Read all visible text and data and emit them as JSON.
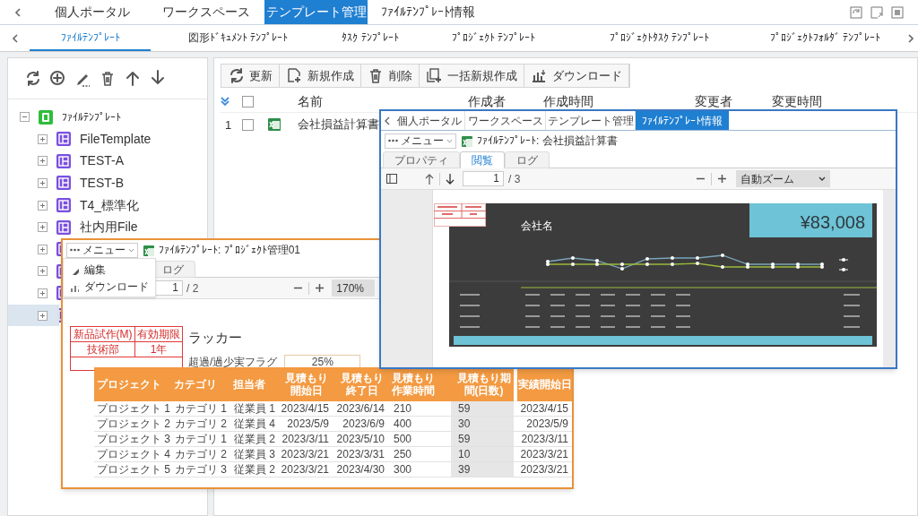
{
  "top_tabs": [
    {
      "label": "個人ポータル",
      "selected": false
    },
    {
      "label": "ワークスペース",
      "selected": false
    },
    {
      "label": "テンプレート管理",
      "selected": true
    },
    {
      "label": "ﾌｧｲﾙﾃﾝﾌﾟﾚｰﾄ情報",
      "selected": false
    }
  ],
  "sub_tabs": [
    {
      "label": "ﾌｧｲﾙﾃﾝﾌﾟﾚｰﾄ",
      "selected": true
    },
    {
      "label": "図形ﾄﾞｷｭﾒﾝﾄ ﾃﾝﾌﾟﾚｰﾄ",
      "selected": false
    },
    {
      "label": "ﾀｽｸ ﾃﾝﾌﾟﾚｰﾄ",
      "selected": false
    },
    {
      "label": "ﾌﾟﾛｼﾞｪｸﾄ ﾃﾝﾌﾟﾚｰﾄ",
      "selected": false
    },
    {
      "label": "ﾌﾟﾛｼﾞｪｸﾄﾀｽｸ ﾃﾝﾌﾟﾚｰﾄ",
      "selected": false
    },
    {
      "label": "ﾌﾟﾛｼﾞｪｸﾄﾌｫﾙﾀﾞ ﾃﾝﾌﾟﾚｰﾄ",
      "selected": false
    }
  ],
  "tree": {
    "root": {
      "label": "ﾌｧｲﾙﾃﾝﾌﾟﾚｰﾄ",
      "expanded": true,
      "children": [
        {
          "label": "FileTemplate",
          "expanded": false,
          "selected": false
        },
        {
          "label": "TEST-A",
          "expanded": false,
          "selected": false
        },
        {
          "label": "TEST-B",
          "expanded": false,
          "selected": false
        },
        {
          "label": "T4_標準化",
          "expanded": false,
          "selected": false
        },
        {
          "label": "社内用File",
          "expanded": false,
          "selected": false
        },
        {
          "expanded": false,
          "selected": false
        },
        {
          "expanded": false,
          "selected": false
        },
        {
          "expanded": false,
          "selected": false
        },
        {
          "expanded": false,
          "selected": true
        }
      ]
    }
  },
  "toolbar": [
    {
      "kind": "refresh",
      "label": "更新"
    },
    {
      "kind": "new",
      "label": "新規作成"
    },
    {
      "kind": "delete",
      "label": "削除"
    },
    {
      "kind": "bulk",
      "label": "一括新規作成"
    },
    {
      "kind": "download",
      "label": "ダウンロード"
    }
  ],
  "table": {
    "all_checked": false,
    "columns": [
      "名前",
      "作成者",
      "作成時間",
      "変更者",
      "変更時間"
    ],
    "rows": [
      {
        "number": "1",
        "checked": false,
        "name": "会社損益計算書"
      }
    ]
  },
  "preview_window": {
    "tabs": [
      {
        "label": "個人ポータル",
        "selected": false
      },
      {
        "label": "ワークスペース",
        "selected": false
      },
      {
        "label": "テンプレート管理",
        "selected": false
      },
      {
        "label": "ﾌｧｲﾙﾃﾝﾌﾟﾚｰﾄ情報",
        "selected": true
      }
    ],
    "menu": "メニュー",
    "title": "ﾌｧｲﾙﾃﾝﾌﾟﾚｰﾄ: 会社損益計算書",
    "view_tabs": [
      {
        "label": "プロパティ",
        "selected": false
      },
      {
        "label": "閲覧",
        "selected": true
      },
      {
        "label": "ログ",
        "selected": false
      }
    ],
    "page": "1",
    "page_count": "/ 3",
    "zoom": "自動ズーム",
    "company": "会社名",
    "total": "¥83,008"
  },
  "project_window": {
    "menu": "メニュー",
    "title": "ﾌｧｲﾙﾃﾝﾌﾟﾚｰﾄ: ﾌﾟﾛｼﾞｪｸﾄ管理01",
    "menu_items": [
      {
        "kind": "edit",
        "label": "編集"
      },
      {
        "kind": "download",
        "label": "ダウンロード"
      }
    ],
    "view_tabs": [
      {
        "label": "ログ",
        "selected": false
      }
    ],
    "page": "1",
    "page_count": "/ 2",
    "zoom": "170%",
    "stamp": [
      [
        "新品試作(M)",
        "有効期限"
      ],
      [
        "技術部",
        "1年"
      ]
    ],
    "heading": "ラッカー",
    "flag_label": "超過/過少実フラグ",
    "flag_value": "25%",
    "columns": [
      "プロジェクト",
      "カテゴリ",
      "担当者",
      "見積もり開始日",
      "見積もり終了日",
      "見積もり作業時間",
      "見積もり期間(日数)",
      "実績開始日"
    ],
    "rows": [
      [
        "プロジェクト 1",
        "カテゴリ 1",
        "従業員 1",
        "2023/4/15",
        "2023/6/14",
        "210",
        "59",
        "2023/4/15"
      ],
      [
        "プロジェクト 2",
        "カテゴリ 2",
        "従業員 4",
        "2023/5/9",
        "2023/6/9",
        "400",
        "30",
        "2023/5/9"
      ],
      [
        "プロジェクト 3",
        "カテゴリ 1",
        "従業員 2",
        "2023/3/11",
        "2023/5/10",
        "500",
        "59",
        "2023/3/11"
      ],
      [
        "プロジェクト 4",
        "カテゴリ 2",
        "従業員 3",
        "2023/3/21",
        "2023/3/31",
        "250",
        "10",
        "2023/3/21"
      ],
      [
        "プロジェクト 5",
        "カテゴリ 3",
        "従業員 2",
        "2023/3/21",
        "2023/4/30",
        "300",
        "39",
        "2023/3/21"
      ]
    ]
  }
}
